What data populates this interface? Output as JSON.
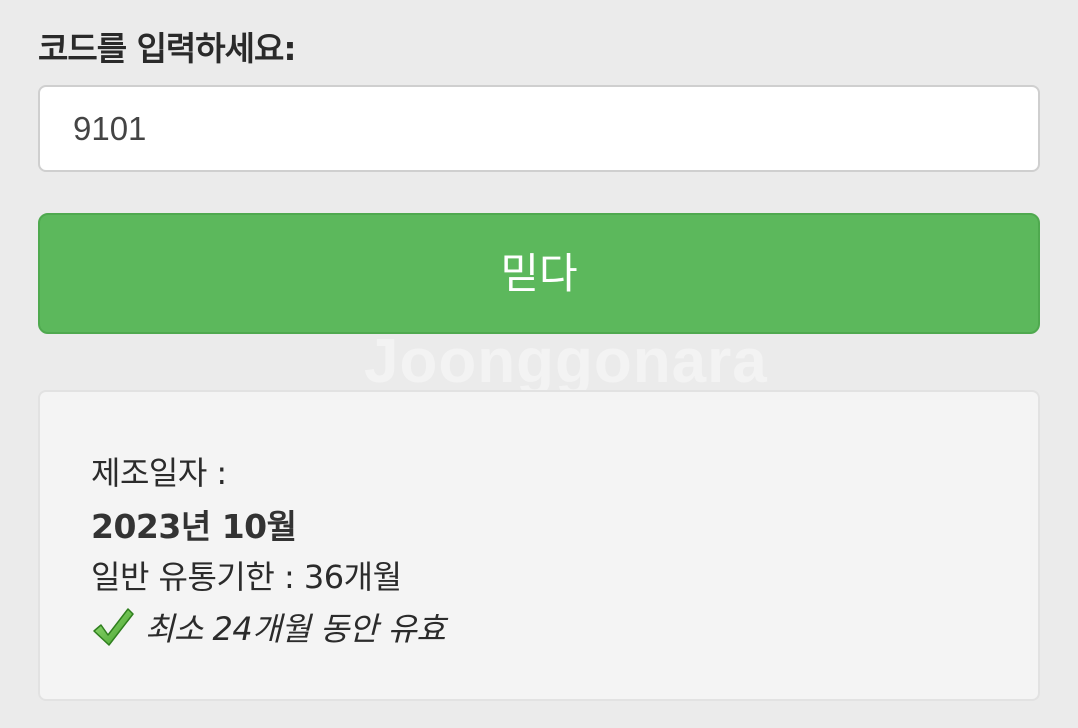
{
  "form": {
    "prompt_label": "코드를 입력하세요:",
    "code_value": "9101",
    "submit_label": "믿다"
  },
  "watermark": "Joonggonara",
  "result": {
    "manufacture_label": "제조일자 :",
    "manufacture_date": "2023년 10월",
    "shelf_life": "일반 유통기한 : 36개월",
    "validity": "최소 24개월 동안 유효",
    "validity_icon": "checkmark-icon"
  },
  "colors": {
    "button_green": "#5cb85c",
    "page_background": "#ebebeb",
    "check_green": "#5fbf3f"
  }
}
